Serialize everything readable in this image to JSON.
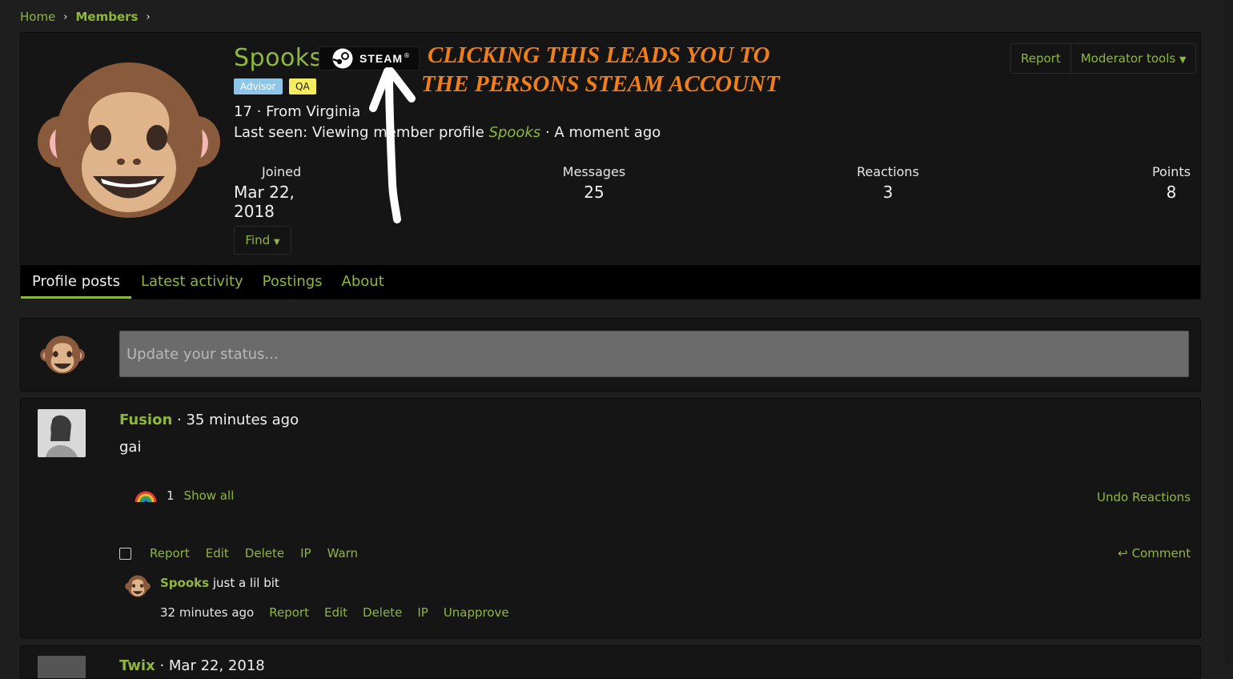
{
  "breadcrumb": {
    "home": "Home",
    "members": "Members",
    "sep": "›"
  },
  "profile": {
    "username": "Spooks",
    "steam_label": "STEAM",
    "steam_reg": "®",
    "annotation_line1": "CLICKING THIS LEADS YOU TO",
    "annotation_line2": "THE PERSONS STEAM ACCOUNT",
    "badges": [
      "Advisor",
      "QA"
    ],
    "info": "17 · From Virginia",
    "last_seen_prefix": "Last seen: Viewing member profile ",
    "last_seen_user": "Spooks",
    "last_seen_suffix": " · A moment ago",
    "stats": [
      {
        "label": "Joined",
        "value": "Mar 22, 2018"
      },
      {
        "label": "Messages",
        "value": "25"
      },
      {
        "label": "Reactions",
        "value": "3"
      },
      {
        "label": "Points",
        "value": "8"
      }
    ],
    "report_label": "Report",
    "moderator_label": "Moderator tools",
    "find_label": "Find"
  },
  "tabs": [
    "Profile posts",
    "Latest activity",
    "Postings",
    "About"
  ],
  "status": {
    "placeholder": "Update your status..."
  },
  "post": {
    "author": "Fusion",
    "time": " · 35 minutes ago",
    "body": "gai",
    "reaction_count": "1",
    "show_all": "Show all",
    "undo_reactions": "Undo Reactions",
    "actions": [
      "Report",
      "Edit",
      "Delete",
      "IP",
      "Warn"
    ],
    "comment_label": "Comment",
    "comment": {
      "author": "Spooks",
      "text": " just a lil bit",
      "time": "32 minutes ago",
      "actions": [
        "Report",
        "Edit",
        "Delete",
        "IP",
        "Unapprove"
      ]
    }
  },
  "next_post": {
    "author": "Twix",
    "time": " · Mar 22, 2018"
  },
  "colors": {
    "accent": "#8fb73b",
    "annotation": "#f07f1a",
    "advisor": "#8fc6e8",
    "qa": "#f6ec5f"
  },
  "icons": [
    "monkey-icon",
    "steam-logo-icon",
    "rainbow-icon",
    "reply-icon",
    "caret-down-icon"
  ]
}
